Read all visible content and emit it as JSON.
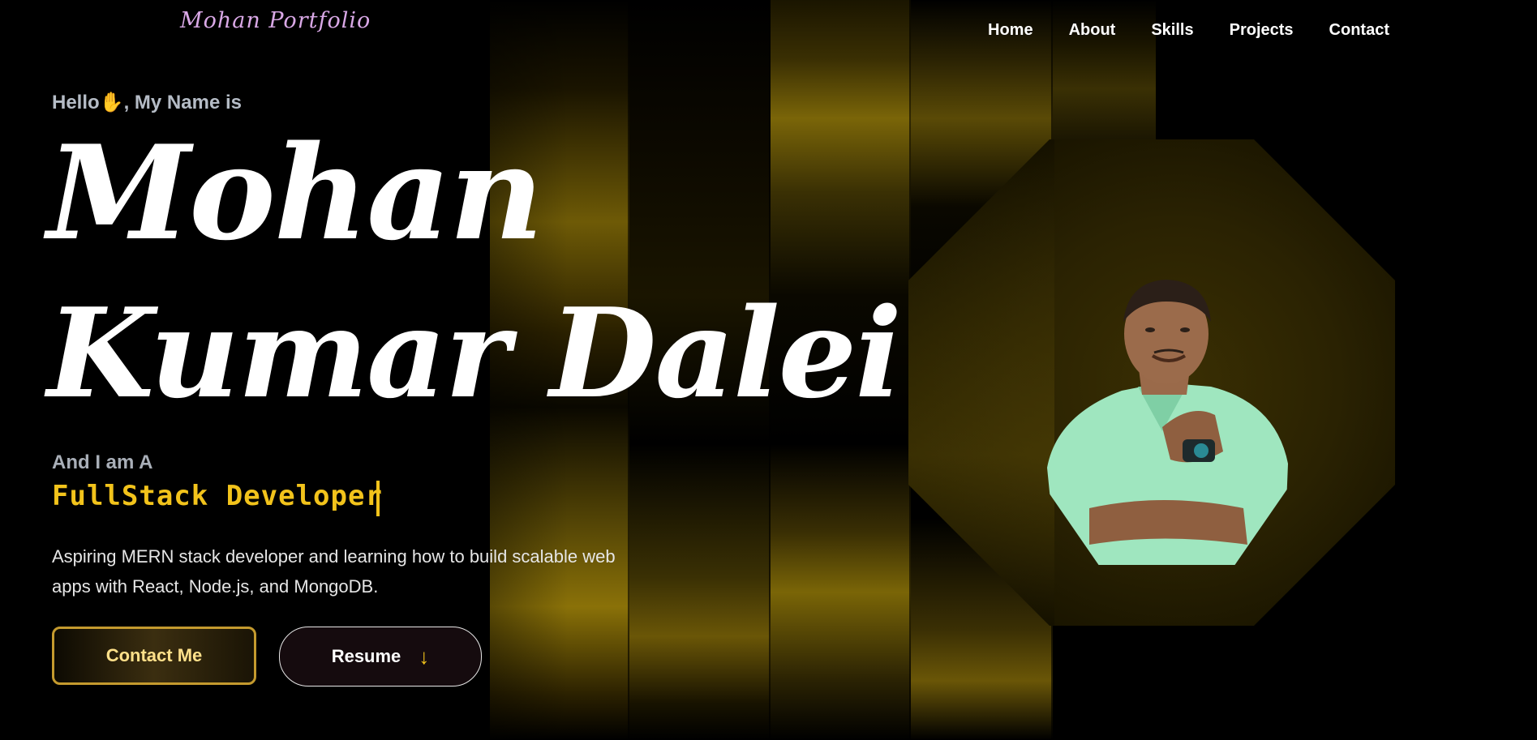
{
  "nav": {
    "logo": "Mohan Portfolio",
    "items": [
      "Home",
      "About",
      "Skills",
      "Projects",
      "Contact"
    ]
  },
  "hero": {
    "greeting_prefix": "Hello",
    "greeting_suffix": ", My Name is",
    "hand_icon": "✋",
    "name_line1": "Mohan",
    "name_line2": "Kumar Dalei",
    "and_i_am": "And I am A",
    "role": "FullStack Developer",
    "description": "Aspiring MERN stack developer and learning how to build scalable web apps with React, Node.js, and MongoDB.",
    "contact_button": "Contact Me",
    "resume_button": "Resume",
    "resume_icon": "↓"
  },
  "theme": {
    "accent": "#f2c31b",
    "logo_color": "#d9a8e6",
    "background": "#000000"
  }
}
